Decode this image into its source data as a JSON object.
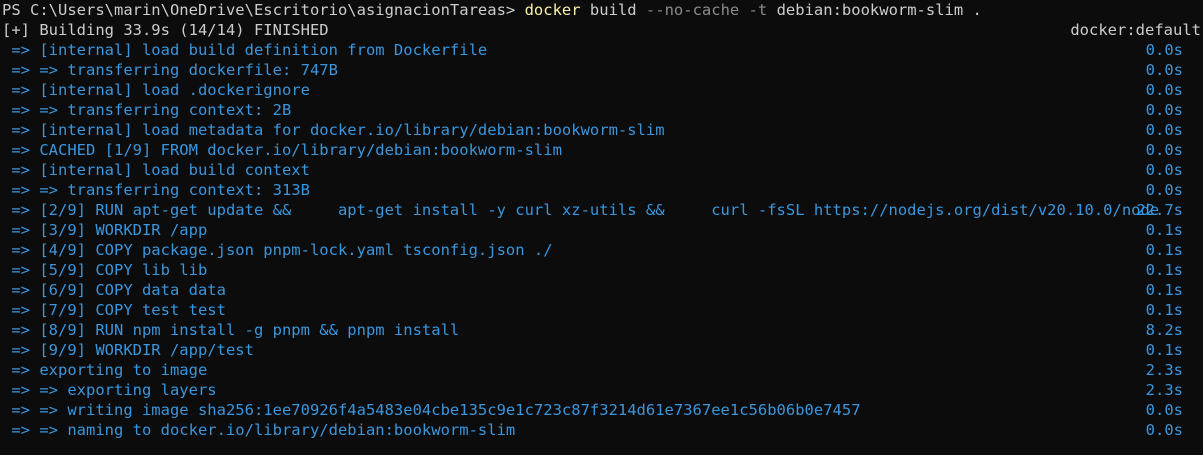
{
  "prompt": {
    "path": "PS C:\\Users\\marin\\OneDrive\\Escritorio\\asignacionTareas> ",
    "command": "docker",
    "subcommand": " build ",
    "flags": "--no-cache -t",
    "argument": " debian:bookworm-slim ."
  },
  "build_status": {
    "text": "[+] Building 33.9s (14/14) FINISHED",
    "context": "docker:default"
  },
  "steps": [
    {
      "text": " => [internal] load build definition from Dockerfile",
      "time": "0.0s"
    },
    {
      "text": " => => transferring dockerfile: 747B",
      "time": "0.0s"
    },
    {
      "text": " => [internal] load .dockerignore",
      "time": "0.0s"
    },
    {
      "text": " => => transferring context: 2B",
      "time": "0.0s"
    },
    {
      "text": " => [internal] load metadata for docker.io/library/debian:bookworm-slim",
      "time": "0.0s"
    },
    {
      "text": " => CACHED [1/9] FROM docker.io/library/debian:bookworm-slim",
      "time": "0.0s"
    },
    {
      "text": " => [internal] load build context",
      "time": "0.0s"
    },
    {
      "text": " => => transferring context: 313B",
      "time": "0.0s"
    },
    {
      "text": " => [2/9] RUN apt-get update &&     apt-get install -y curl xz-utils &&     curl -fsSL https://nodejs.org/dist/v20.10.0/node",
      "time": "22.7s"
    },
    {
      "text": " => [3/9] WORKDIR /app",
      "time": "0.1s"
    },
    {
      "text": " => [4/9] COPY package.json pnpm-lock.yaml tsconfig.json ./",
      "time": "0.1s"
    },
    {
      "text": " => [5/9] COPY lib lib",
      "time": "0.1s"
    },
    {
      "text": " => [6/9] COPY data data",
      "time": "0.1s"
    },
    {
      "text": " => [7/9] COPY test test",
      "time": "0.1s"
    },
    {
      "text": " => [8/9] RUN npm install -g pnpm && pnpm install",
      "time": "8.2s"
    },
    {
      "text": " => [9/9] WORKDIR /app/test",
      "time": "0.1s"
    },
    {
      "text": " => exporting to image",
      "time": "2.3s"
    },
    {
      "text": " => => exporting layers",
      "time": "2.3s"
    },
    {
      "text": " => => writing image sha256:1ee70926f4a5483e04cbe135c9e1c723c87f3214d61e7367ee1c56b06b0e7457",
      "time": "0.0s"
    },
    {
      "text": " => => naming to docker.io/library/debian:bookworm-slim",
      "time": "0.0s"
    }
  ],
  "colors": {
    "background": "#0c0c0c",
    "text": "#cccccc",
    "step": "#3a96dd",
    "command": "#f9f1a5",
    "flag": "#8a8a8a"
  }
}
